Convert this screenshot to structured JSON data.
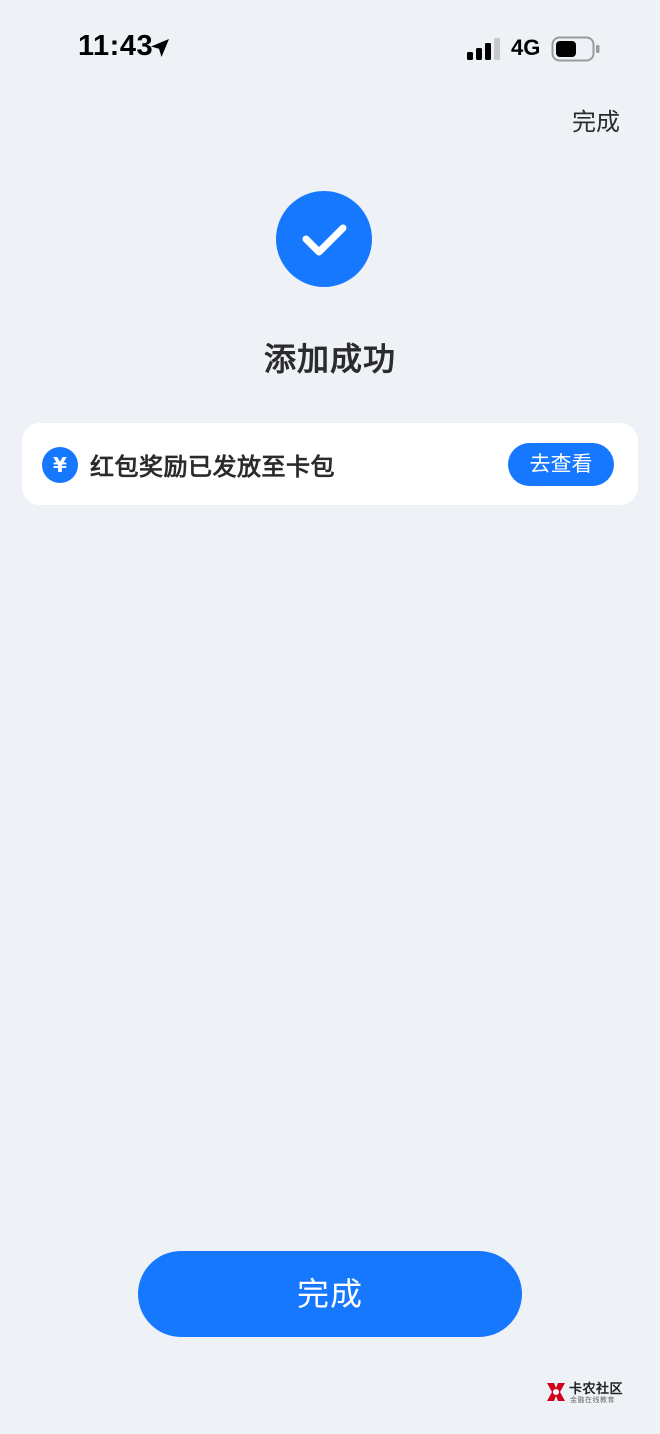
{
  "status_bar": {
    "time": "11:43",
    "network": "4G"
  },
  "nav": {
    "done_label": "完成"
  },
  "success": {
    "title": "添加成功"
  },
  "reward_card": {
    "icon_symbol": "¥",
    "text": "红包奖励已发放至卡包",
    "view_label": "去查看"
  },
  "footer": {
    "done_label": "完成"
  },
  "watermark": {
    "name": "卡农社区",
    "tagline": "金融在线教育"
  },
  "colors": {
    "accent": "#1677ff",
    "background": "#eef2f7",
    "card": "#ffffff",
    "text": "#2b2b2b"
  },
  "icons": {
    "location": "location-arrow-icon",
    "signal": "signal-bars-icon",
    "battery": "battery-icon",
    "success": "checkmark-icon",
    "yuan": "yuan-icon",
    "watermark_logo": "kanong-logo-icon"
  }
}
